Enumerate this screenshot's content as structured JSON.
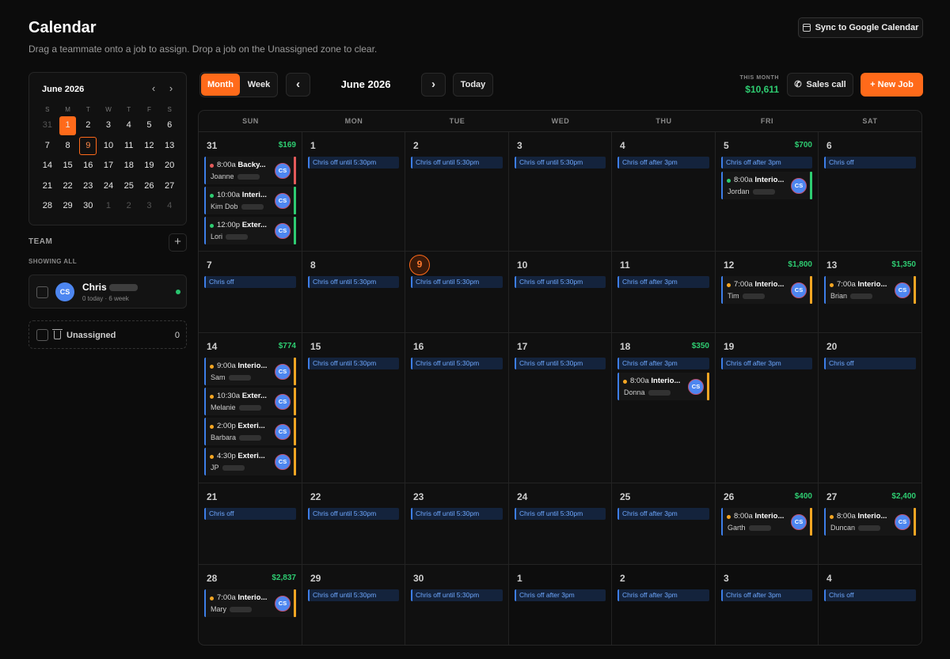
{
  "header": {
    "title": "Calendar",
    "subtitle": "Drag a teammate onto a job to assign. Drop a job on the Unassigned zone to clear.",
    "sync_label": "Sync to Google Calendar"
  },
  "mini_calendar": {
    "month_label": "June 2026",
    "prev_icon": "chevron-left-icon",
    "next_icon": "chevron-right-icon",
    "weekdays": [
      "S",
      "M",
      "T",
      "W",
      "T",
      "F",
      "S"
    ],
    "days": [
      {
        "d": "31",
        "dim": true
      },
      {
        "d": "1",
        "sel": true
      },
      {
        "d": "2"
      },
      {
        "d": "3"
      },
      {
        "d": "4"
      },
      {
        "d": "5"
      },
      {
        "d": "6"
      },
      {
        "d": "7"
      },
      {
        "d": "8"
      },
      {
        "d": "9",
        "today": true
      },
      {
        "d": "10"
      },
      {
        "d": "11"
      },
      {
        "d": "12"
      },
      {
        "d": "13"
      },
      {
        "d": "14"
      },
      {
        "d": "15"
      },
      {
        "d": "16"
      },
      {
        "d": "17"
      },
      {
        "d": "18"
      },
      {
        "d": "19"
      },
      {
        "d": "20"
      },
      {
        "d": "21"
      },
      {
        "d": "22"
      },
      {
        "d": "23"
      },
      {
        "d": "24"
      },
      {
        "d": "25"
      },
      {
        "d": "26"
      },
      {
        "d": "27"
      },
      {
        "d": "28"
      },
      {
        "d": "29"
      },
      {
        "d": "30"
      },
      {
        "d": "1",
        "dim": true
      },
      {
        "d": "2",
        "dim": true
      },
      {
        "d": "3",
        "dim": true
      },
      {
        "d": "4",
        "dim": true
      }
    ]
  },
  "team": {
    "label": "TEAM",
    "add_label": "+",
    "showing": "SHOWING ALL",
    "member": {
      "initials": "CS",
      "name": "Chris",
      "stats": "0 today · 6 week"
    },
    "unassigned_label": "Unassigned",
    "unassigned_count": "0"
  },
  "toolbar": {
    "month_label": "Month",
    "week_label": "Week",
    "prev": "‹",
    "next": "›",
    "current_month": "June 2026",
    "today_label": "Today",
    "this_month_label": "THIS MONTH",
    "this_month_value": "$10,611",
    "sales_call_label": "Sales call",
    "new_job_label": "+  New Job"
  },
  "colors": {
    "accent": "#ff6a1a",
    "money": "#2ecc71",
    "off": "#3d7ee8",
    "dot_red": "#e45a5a",
    "dot_green": "#2ecc71",
    "dot_orange": "#f5a623"
  },
  "calendar": {
    "weekdays": [
      "SUN",
      "MON",
      "TUE",
      "WED",
      "THU",
      "FRI",
      "SAT"
    ],
    "weeks": [
      [
        {
          "day": "31",
          "amount": "$169",
          "off": "",
          "jobs": [
            {
              "time": "8:00a",
              "title": "Backy...",
              "customer": "Joanne",
              "color": "red"
            },
            {
              "time": "10:00a",
              "title": "Interi...",
              "customer": "Kim Dob",
              "color": "green"
            },
            {
              "time": "12:00p",
              "title": "Exter...",
              "customer": "Lori",
              "color": "green"
            }
          ]
        },
        {
          "day": "1",
          "off": "Chris off until 5:30pm",
          "jobs": []
        },
        {
          "day": "2",
          "off": "Chris off until 5:30pm",
          "jobs": []
        },
        {
          "day": "3",
          "off": "Chris off until 5:30pm",
          "jobs": []
        },
        {
          "day": "4",
          "off": "Chris off after 3pm",
          "jobs": []
        },
        {
          "day": "5",
          "amount": "$700",
          "off": "Chris off after 3pm",
          "jobs": [
            {
              "time": "8:00a",
              "title": "Interio...",
              "customer": "Jordan",
              "color": "green"
            }
          ]
        },
        {
          "day": "6",
          "off": "Chris off",
          "jobs": []
        }
      ],
      [
        {
          "day": "7",
          "off": "Chris off",
          "jobs": []
        },
        {
          "day": "8",
          "off": "Chris off until 5:30pm",
          "jobs": []
        },
        {
          "day": "9",
          "today": true,
          "off": "Chris off until 5:30pm",
          "jobs": []
        },
        {
          "day": "10",
          "off": "Chris off until 5:30pm",
          "jobs": []
        },
        {
          "day": "11",
          "off": "Chris off after 3pm",
          "jobs": []
        },
        {
          "day": "12",
          "amount": "$1,800",
          "off": "",
          "jobs": [
            {
              "time": "7:00a",
              "title": "Interio...",
              "customer": "Tim",
              "color": "orange"
            }
          ]
        },
        {
          "day": "13",
          "amount": "$1,350",
          "off": "",
          "jobs": [
            {
              "time": "7:00a",
              "title": "Interio...",
              "customer": "Brian",
              "color": "orange"
            }
          ]
        }
      ],
      [
        {
          "day": "14",
          "amount": "$774",
          "off": "",
          "jobs": [
            {
              "time": "9:00a",
              "title": "Interio...",
              "customer": "Sam",
              "color": "orange"
            },
            {
              "time": "10:30a",
              "title": "Exter...",
              "customer": "Melanie",
              "color": "orange"
            },
            {
              "time": "2:00p",
              "title": "Exteri...",
              "customer": "Barbara",
              "color": "orange"
            },
            {
              "time": "4:30p",
              "title": "Exteri...",
              "customer": "JP",
              "color": "orange"
            }
          ]
        },
        {
          "day": "15",
          "off": "Chris off until 5:30pm",
          "jobs": []
        },
        {
          "day": "16",
          "off": "Chris off until 5:30pm",
          "jobs": []
        },
        {
          "day": "17",
          "off": "Chris off until 5:30pm",
          "jobs": []
        },
        {
          "day": "18",
          "amount": "$350",
          "off": "Chris off after 3pm",
          "jobs": [
            {
              "time": "8:00a",
              "title": "Interio...",
              "customer": "Donna",
              "color": "orange"
            }
          ]
        },
        {
          "day": "19",
          "off": "Chris off after 3pm",
          "jobs": []
        },
        {
          "day": "20",
          "off": "Chris off",
          "jobs": []
        }
      ],
      [
        {
          "day": "21",
          "off": "Chris off",
          "jobs": []
        },
        {
          "day": "22",
          "off": "Chris off until 5:30pm",
          "jobs": []
        },
        {
          "day": "23",
          "off": "Chris off until 5:30pm",
          "jobs": []
        },
        {
          "day": "24",
          "off": "Chris off until 5:30pm",
          "jobs": []
        },
        {
          "day": "25",
          "off": "Chris off after 3pm",
          "jobs": []
        },
        {
          "day": "26",
          "amount": "$400",
          "off": "",
          "jobs": [
            {
              "time": "8:00a",
              "title": "Interio...",
              "customer": "Garth",
              "color": "orange"
            }
          ]
        },
        {
          "day": "27",
          "amount": "$2,400",
          "off": "",
          "jobs": [
            {
              "time": "8:00a",
              "title": "Interio...",
              "customer": "Duncan",
              "color": "orange"
            }
          ]
        }
      ],
      [
        {
          "day": "28",
          "amount": "$2,837",
          "off": "",
          "jobs": [
            {
              "time": "7:00a",
              "title": "Interio...",
              "customer": "Mary",
              "color": "orange"
            }
          ]
        },
        {
          "day": "29",
          "off": "Chris off until 5:30pm",
          "jobs": []
        },
        {
          "day": "30",
          "off": "Chris off until 5:30pm",
          "jobs": []
        },
        {
          "day": "1",
          "other": true,
          "off": "Chris off after 3pm",
          "jobs": []
        },
        {
          "day": "2",
          "other": true,
          "off": "Chris off after 3pm",
          "jobs": []
        },
        {
          "day": "3",
          "other": true,
          "off": "Chris off after 3pm",
          "jobs": []
        },
        {
          "day": "4",
          "other": true,
          "off": "Chris off",
          "jobs": []
        }
      ]
    ]
  }
}
